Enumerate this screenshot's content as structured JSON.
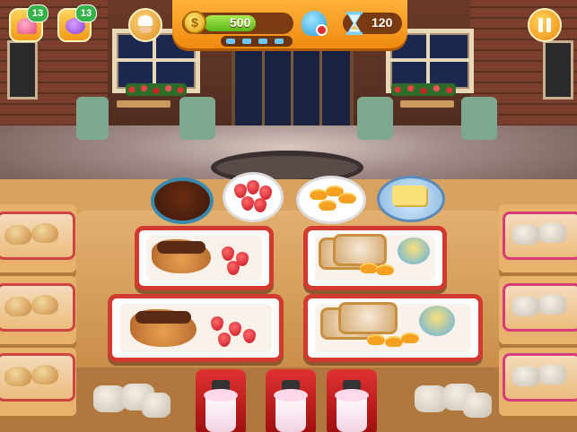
{
  "hud": {
    "coins": "500",
    "coin_progress": 0.6,
    "level_progress_segments_filled": 4,
    "level_progress_segments_total": 4,
    "time": "120",
    "boosts": [
      {
        "name": "cupcake-boost",
        "count": "13"
      },
      {
        "name": "candy-boost",
        "count": "13"
      }
    ]
  },
  "icons": {
    "coin": "$",
    "pause": "pause-icon",
    "chef": "chef-hat-icon",
    "customer_ghost": "ghost-icon",
    "timer": "hourglass-icon"
  },
  "colors": {
    "hud_orange": "#f39a1c",
    "coin_bar": "#6fcf2a",
    "tray_rim": "#d23a30",
    "badge_green": "#35b24a"
  }
}
